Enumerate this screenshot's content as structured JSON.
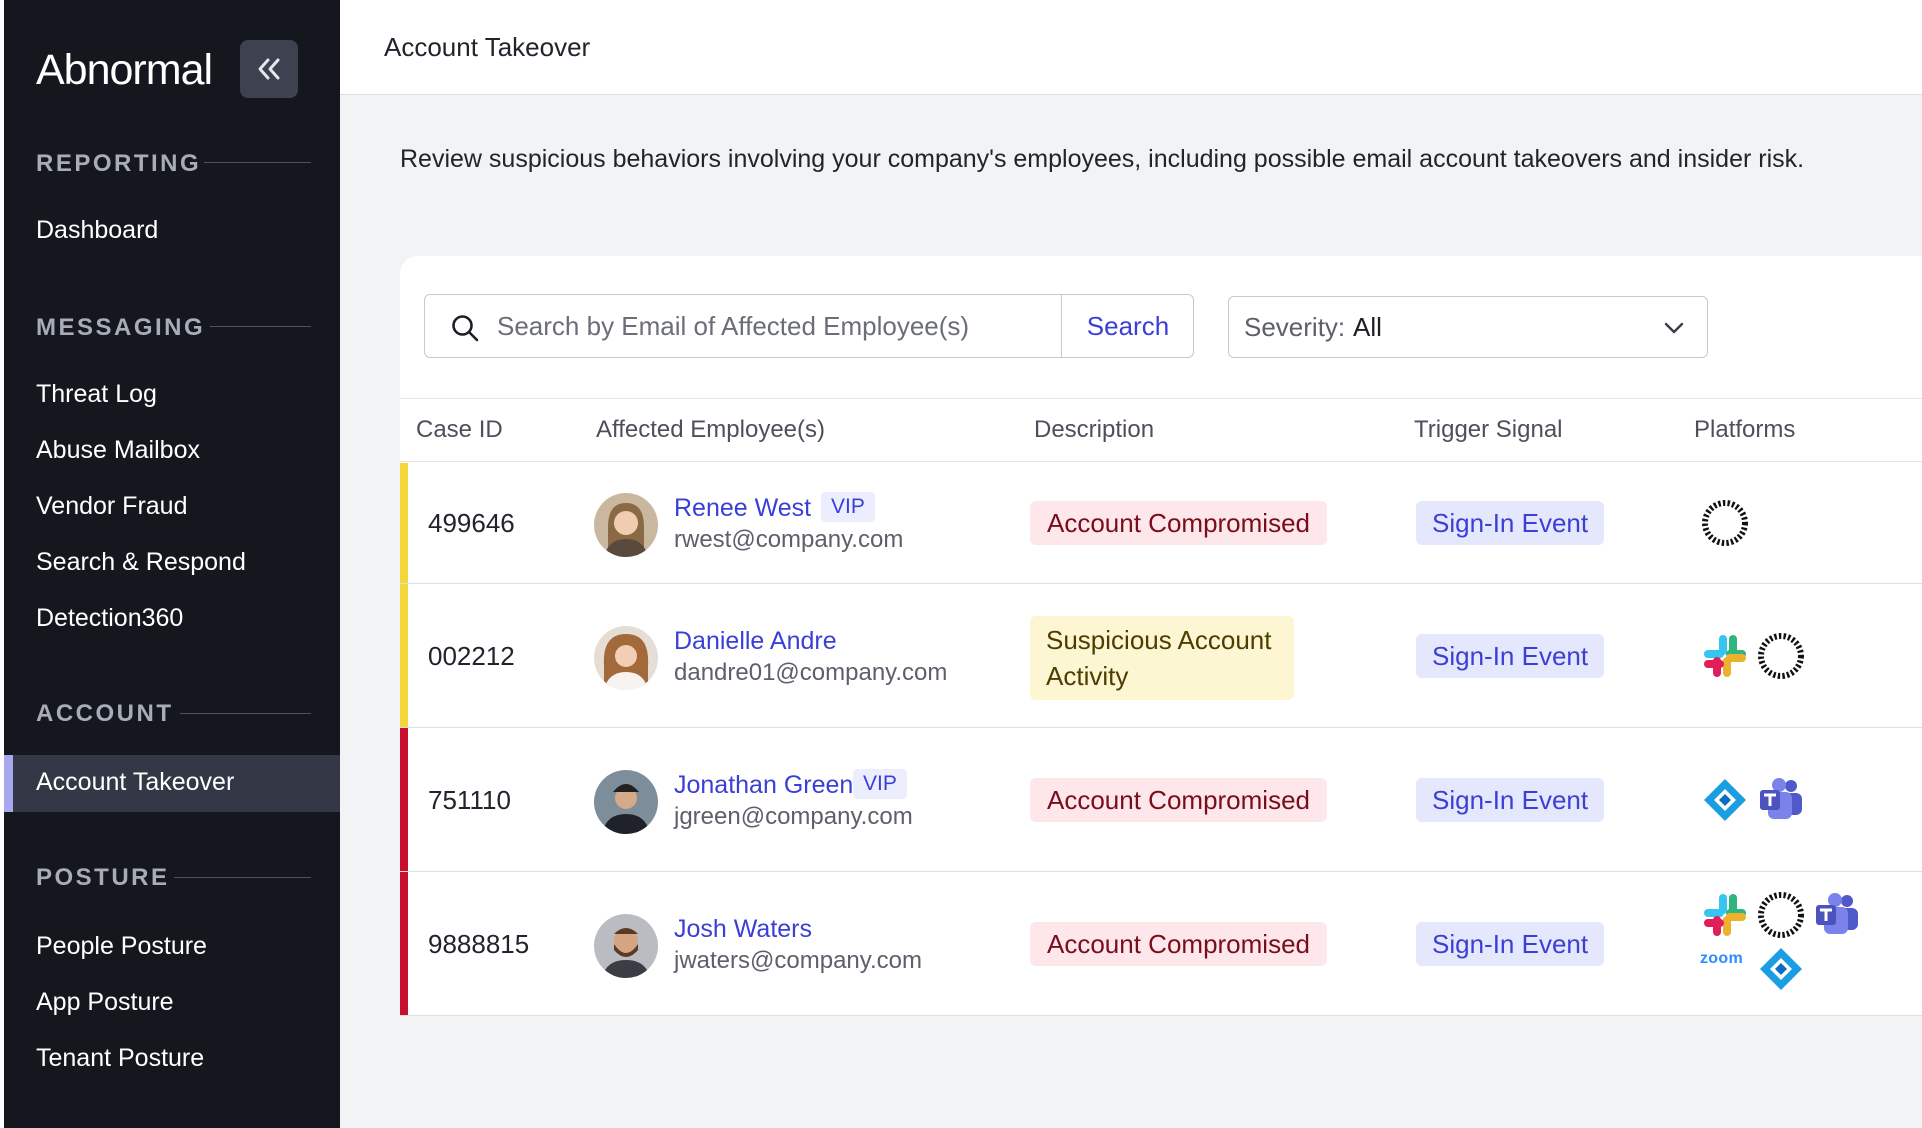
{
  "sidebar": {
    "logo": "Abnormal",
    "sections": [
      {
        "title": "REPORTING",
        "items": [
          "Dashboard"
        ]
      },
      {
        "title": "MESSAGING",
        "items": [
          "Threat Log",
          "Abuse Mailbox",
          "Vendor Fraud",
          "Search & Respond",
          "Detection360"
        ]
      },
      {
        "title": "ACCOUNT",
        "items": [
          "Account Takeover"
        ]
      },
      {
        "title": "POSTURE",
        "items": [
          "People Posture",
          "App Posture",
          "Tenant Posture"
        ]
      }
    ],
    "active_item": "Account Takeover"
  },
  "header": {
    "title": "Account Takeover"
  },
  "intro": "Review suspicious behaviors involving your company's employees, including possible email account takeovers and insider risk.",
  "search": {
    "placeholder": "Search by Email of Affected Employee(s)",
    "button": "Search"
  },
  "severity": {
    "label": "Severity:",
    "value": "All"
  },
  "table": {
    "headers": [
      "Case ID",
      "Affected Employee(s)",
      "Description",
      "Trigger Signal",
      "Platforms"
    ],
    "rows": [
      {
        "case_id": "499646",
        "name": "Renee West",
        "vip": "VIP",
        "email": "rwest@company.com",
        "description": "Account Compromised",
        "signal": "Sign-In Event",
        "platforms": [
          "okta-icon"
        ],
        "severity_color": "#f4d83a"
      },
      {
        "case_id": "002212",
        "name": "Danielle Andre",
        "vip": "",
        "email": "dandre01@company.com",
        "description": "Suspicious Account Activity",
        "signal": "Sign-In Event",
        "platforms": [
          "slack-icon",
          "okta-icon"
        ],
        "severity_color": "#f4d83a"
      },
      {
        "case_id": "751110",
        "name": "Jonathan Green",
        "vip": "VIP",
        "email": "jgreen@company.com",
        "description": "Account Compromised",
        "signal": "Sign-In Event",
        "platforms": [
          "azure-ad-icon",
          "teams-icon"
        ],
        "severity_color": "#c8102e"
      },
      {
        "case_id": "9888815",
        "name": "Josh Waters",
        "vip": "",
        "email": "jwaters@company.com",
        "description": "Account Compromised",
        "signal": "Sign-In Event",
        "platforms": [
          "slack-icon",
          "okta-icon",
          "teams-icon",
          "zoom-icon",
          "azure-ad-icon"
        ],
        "severity_color": "#c8102e"
      }
    ]
  },
  "platform_labels": {
    "zoom": "zoom"
  },
  "colors": {
    "accent": "#3a3fd6",
    "sidebar_bg": "#15171e",
    "active_bar": "#a7a8ee",
    "critical": "#c8102e",
    "warning": "#f4d83a"
  }
}
